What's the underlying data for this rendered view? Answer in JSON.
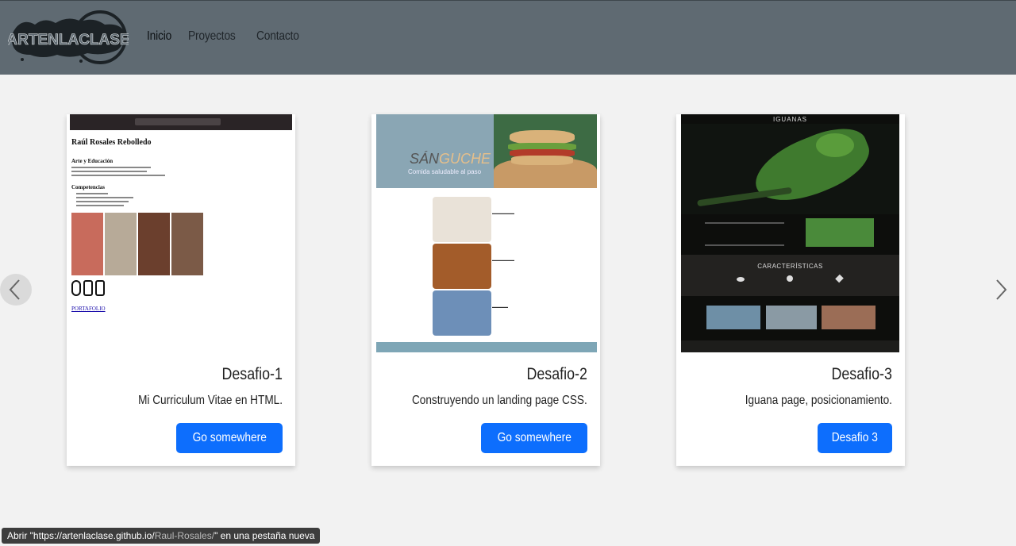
{
  "navbar": {
    "logo_text": "ARTENLACLASE",
    "links": [
      "Inicio",
      "Proyectos",
      "Contacto"
    ]
  },
  "cards": [
    {
      "title": "Desafio-1",
      "text": "Mi Curriculum Vitae en HTML.",
      "button": "Go somewhere",
      "preview": {
        "name": "Raúl Rosales Rebolledo",
        "section1": "Arte y Educación",
        "section2": "Competencias",
        "link": "PORTAFOLIO"
      }
    },
    {
      "title": "Desafio-2",
      "text": "Construyendo un landing page CSS.",
      "button": "Go somewhere",
      "preview": {
        "brand_a": "SÁN",
        "brand_b": "GUCHE",
        "slogan": "Comida saludable al paso"
      }
    },
    {
      "title": "Desafio-3",
      "text": "Iguana page, posicionamiento.",
      "button": "Desafio 3",
      "preview": {
        "heading": "IGUANAS",
        "features": "CARACTERÍSTICAS"
      }
    }
  ],
  "status_bar": {
    "prefix": "Abrir \"https://artenlaclase.github.io/",
    "path": "Raul-Rosales/",
    "suffix": "\" en una pestaña nueva"
  }
}
